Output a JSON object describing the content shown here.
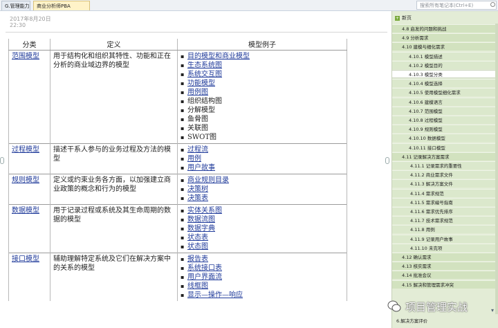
{
  "tabs": [
    {
      "label": "G.管理能力"
    },
    {
      "label": "商业分析师PBA"
    }
  ],
  "search": {
    "placeholder": "搜索所有笔记本(Ctrl+E)"
  },
  "note": {
    "date": "2017年8月20日",
    "time": "22:30"
  },
  "table": {
    "headers": [
      "分类",
      "定义",
      "模型例子"
    ],
    "rows": [
      {
        "category": "范围模型",
        "definition": "用于结构化和组织其特性、功能和正在分析的商业域边界的模型",
        "examples": [
          {
            "text": "目的模型和商业模型",
            "link": true
          },
          {
            "text": "生态系统图",
            "link": true
          },
          {
            "text": "系统交互图",
            "link": true
          },
          {
            "text": "功能模型",
            "link": true
          },
          {
            "text": "用例图",
            "link": true
          },
          {
            "text": "组织结构图",
            "link": false
          },
          {
            "text": "分解模型",
            "link": false
          },
          {
            "text": "鱼骨图",
            "link": false
          },
          {
            "text": "关联图",
            "link": false
          },
          {
            "text": "SWOT图",
            "link": false
          }
        ]
      },
      {
        "category": "过程模型",
        "definition": "描述干系人参与的业务过程及方法的模型",
        "examples": [
          {
            "text": "过程流",
            "link": true
          },
          {
            "text": "用例",
            "link": true
          },
          {
            "text": "用户故事",
            "link": true
          }
        ]
      },
      {
        "category": "规则模型",
        "definition": "定义或约束业务各方面，以加强建立商业政策的概念和行为的模型",
        "examples": [
          {
            "text": "商业规则目录",
            "link": true
          },
          {
            "text": "决策树",
            "link": true
          },
          {
            "text": "决策表",
            "link": true
          }
        ]
      },
      {
        "category": "数据模型",
        "definition": "用于记录过程或系统及其生命周期的数据的模型",
        "examples": [
          {
            "text": "实体关系图",
            "link": true
          },
          {
            "text": "数据流图",
            "link": true
          },
          {
            "text": "数据字典",
            "link": true
          },
          {
            "text": "状态表",
            "link": true
          },
          {
            "text": "状态图",
            "link": true
          }
        ]
      },
      {
        "category": "接口模型",
        "definition": "辅助理解特定系统及它们在解决方案中的关系的模型",
        "examples": [
          {
            "text": "报告表",
            "link": true
          },
          {
            "text": "系统接口表",
            "link": true
          },
          {
            "text": "用户界面流",
            "link": true
          },
          {
            "text": "线框图",
            "link": true
          },
          {
            "text": "显示—操作—响应",
            "link": true
          }
        ]
      }
    ]
  },
  "sidebar": {
    "new_page": "新页",
    "items": [
      {
        "label": "4.8 启发的问题和挑战",
        "level": 1
      },
      {
        "label": "4.9 分析需求",
        "level": 1
      },
      {
        "label": "4.10 建模与细化需求",
        "level": 1
      },
      {
        "label": "4.10.1 模型描述",
        "level": 2
      },
      {
        "label": "4.10.2 模型目的",
        "level": 2
      },
      {
        "label": "4.10.3 模型分类",
        "level": 2,
        "selected": true
      },
      {
        "label": "4.10.4 模型选择",
        "level": 2
      },
      {
        "label": "4.10.5 使用模型细化需求",
        "level": 2
      },
      {
        "label": "4.10.6 建模语言",
        "level": 2
      },
      {
        "label": "4.10.7 范围模型",
        "level": 2
      },
      {
        "label": "4.10.8 过程模型",
        "level": 2
      },
      {
        "label": "4.10.9 规则模型",
        "level": 2
      },
      {
        "label": "4.10.10 数据模型",
        "level": 2
      },
      {
        "label": "4.10.11 接口模型",
        "level": 2
      },
      {
        "label": "4.11 记录解决方案需求",
        "level": 1
      },
      {
        "label": "4.11.1 记录需求的重要性",
        "level": 3
      },
      {
        "label": "4.11.2 商业需求文件",
        "level": 3
      },
      {
        "label": "4.11.3 解决方案文件",
        "level": 3
      },
      {
        "label": "4.11.4 需求规范",
        "level": 3
      },
      {
        "label": "4.11.5 需求编号指南",
        "level": 3
      },
      {
        "label": "4.11.6 需求优先排序",
        "level": 3
      },
      {
        "label": "4.11.7 技术需求规范",
        "level": 3
      },
      {
        "label": "4.11.8 用例",
        "level": 3
      },
      {
        "label": "4.11.9 记录用户故事",
        "level": 3
      },
      {
        "label": "4.11.10 未完项",
        "level": 3
      },
      {
        "label": "4.12 确认需求",
        "level": 1
      },
      {
        "label": "4.13 核实需求",
        "level": 1
      },
      {
        "label": "4.14 批准会议",
        "level": 1
      },
      {
        "label": "4.15 解决和管理需求冲突",
        "level": 1
      }
    ],
    "last_item": "6.解决方案评价"
  },
  "watermark": {
    "text": "项目管理实战"
  }
}
